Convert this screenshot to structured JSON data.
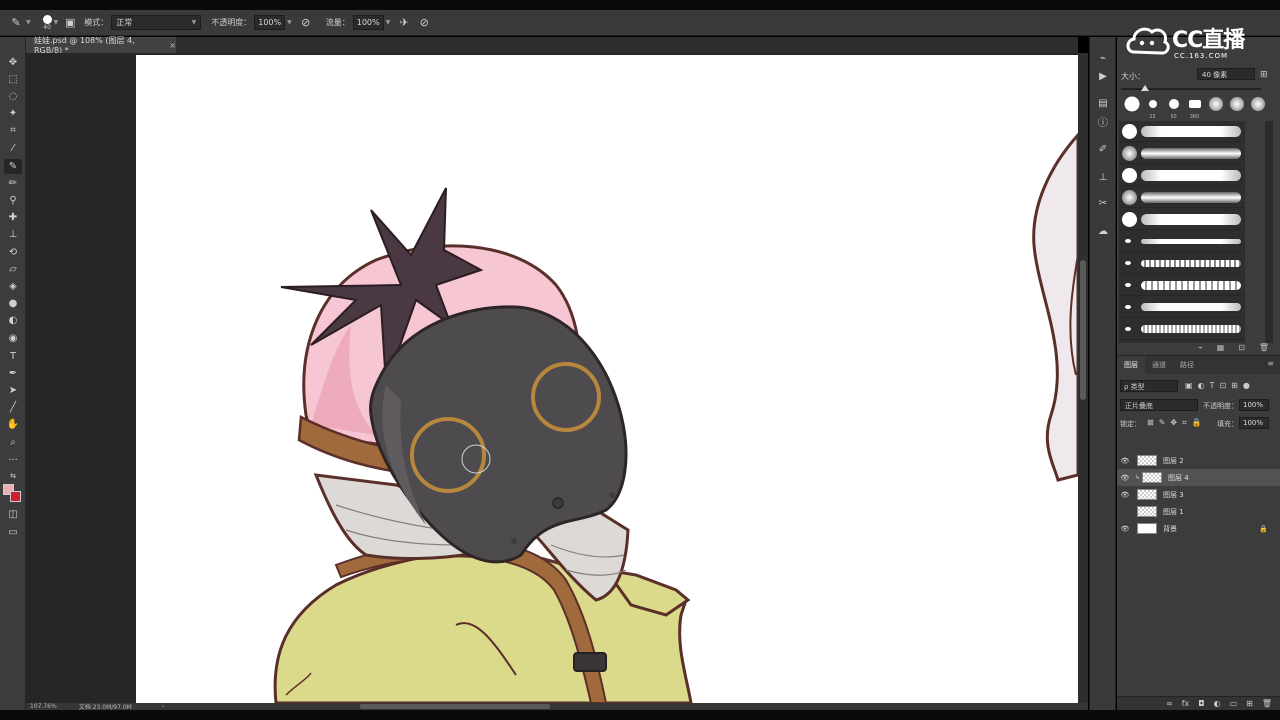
{
  "options_bar": {
    "brush_size": "40",
    "mode_label": "模式：",
    "mode_value": "正常",
    "opacity_label": "不透明度：",
    "opacity_value": "100%",
    "flow_label": "流量：",
    "flow_value": "100%"
  },
  "document": {
    "tab_title": "娃娃.psd @ 108% (图层 4, RGB/8) *",
    "close_glyph": "×"
  },
  "status_bar": {
    "zoom": "107.76%",
    "doc_info": "文档:23.0M/97.0M"
  },
  "brush_panel": {
    "size_label": "大小：",
    "size_value": "40 像素",
    "presets": [
      {
        "num": ""
      },
      {
        "num": "15"
      },
      {
        "num": "50"
      },
      {
        "num": "360"
      },
      {
        "num": ""
      },
      {
        "num": ""
      },
      {
        "num": ""
      }
    ]
  },
  "layers_panel": {
    "tabs": [
      "图层",
      "通道",
      "路径"
    ],
    "filter_label": "ρ 类型",
    "blend_mode": "正片叠底",
    "opacity_label": "不透明度：",
    "opacity_value": "100%",
    "lock_label": "锁定：",
    "fill_label": "填充：",
    "fill_value": "100%",
    "layers": [
      {
        "name": "图层 2",
        "visible": true,
        "active": false
      },
      {
        "name": "图层 4",
        "visible": true,
        "active": true
      },
      {
        "name": "图层 3",
        "visible": true,
        "active": false
      },
      {
        "name": "图层 1",
        "visible": false,
        "active": false
      },
      {
        "name": "背景",
        "visible": true,
        "active": false
      }
    ]
  },
  "watermark": {
    "brand": "CC直播",
    "url": "CC.163.COM"
  },
  "colors": {
    "foreground": "#e9aeb1",
    "background": "#cc1f30",
    "helmet_pink": "#f6c6d3",
    "mask_gray": "#4d4b4d",
    "jacket_yellow": "#dbd98a",
    "strap_brown": "#a06a3c"
  },
  "icons": {
    "tools": [
      "move-icon",
      "marquee-icon",
      "lasso-icon",
      "magic-wand-icon",
      "crop-icon",
      "eyedropper-icon",
      "brush-icon",
      "pencil-icon",
      "clone-stamp-icon",
      "history-brush-icon",
      "eraser-icon",
      "paint-bucket-icon",
      "blur-icon",
      "dodge-icon",
      "pen-icon",
      "type-icon",
      "path-selection-icon",
      "line-icon",
      "hand-icon",
      "zoom-icon",
      "more-icon"
    ]
  }
}
